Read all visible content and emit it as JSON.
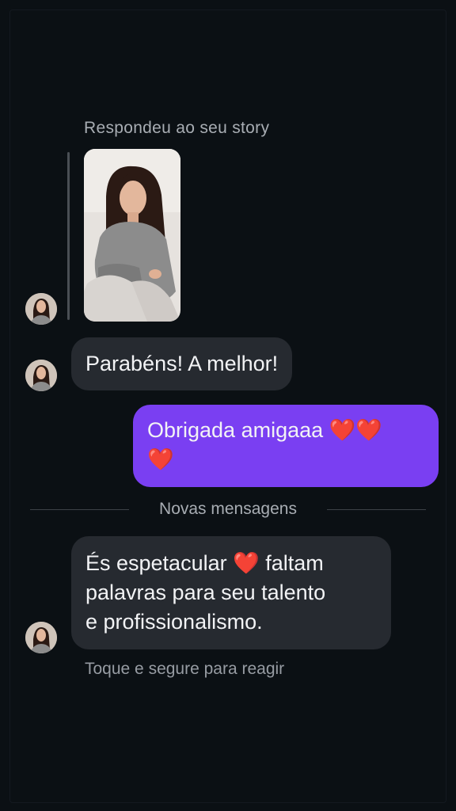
{
  "colors": {
    "background": "#0b1014",
    "incoming_bubble": "#262a30",
    "outgoing_bubble": "#7a3ff2",
    "heart": "#e8223a"
  },
  "story_reply": {
    "caption": "Respondeu ao seu story"
  },
  "messages": [
    {
      "direction": "incoming",
      "text": "Parabéns! A melhor!"
    },
    {
      "direction": "outgoing",
      "line1": "Obrigada amigaaa ",
      "line2": ""
    },
    {
      "direction": "incoming",
      "line1": "És espetacular ",
      "line1b": " faltam",
      "line2": "palavras para seu talento",
      "line3": "e profissionalismo."
    }
  ],
  "divider": {
    "label": "Novas mensagens"
  },
  "hint": "Toque e segure para reagir"
}
